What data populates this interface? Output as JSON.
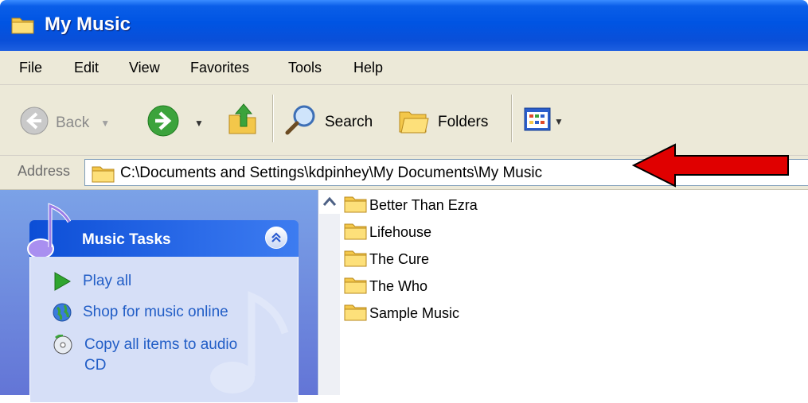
{
  "window": {
    "title": "My Music"
  },
  "menu": [
    "File",
    "Edit",
    "View",
    "Favorites",
    "Tools",
    "Help"
  ],
  "toolbar": {
    "back_label": "Back",
    "search_label": "Search",
    "folders_label": "Folders"
  },
  "address": {
    "label": "Address",
    "path": "C:\\Documents and Settings\\kdpinhey\\My Documents\\My Music"
  },
  "tasks": {
    "title": "Music Tasks",
    "items": [
      {
        "label": "Play all",
        "icon": "play-icon"
      },
      {
        "label": "Shop for music online",
        "icon": "globe-icon"
      },
      {
        "label": "Copy all items to audio CD",
        "icon": "cd-icon"
      }
    ]
  },
  "folders": [
    "Better Than Ezra",
    "Lifehouse",
    "The Cure",
    "The Who",
    "Sample Music"
  ],
  "colors": {
    "titlebar": "#0054e3",
    "task_link": "#215dc6",
    "pane": "#6375d6",
    "annotation_arrow": "#e00000"
  }
}
